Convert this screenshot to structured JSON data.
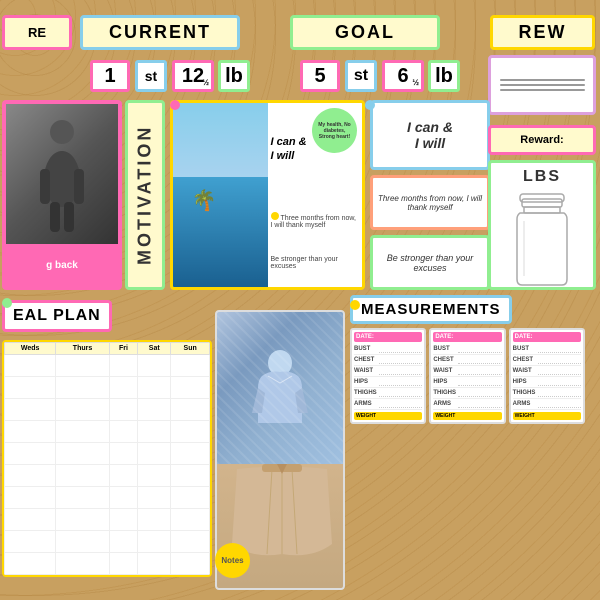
{
  "header": {
    "before_label": "RE",
    "current_label": "CURRENT",
    "goal_label": "GOAL",
    "reward_label": "REW"
  },
  "current_weight": {
    "stones": "1",
    "stones_unit": "st",
    "lbs": "12",
    "half": "½",
    "lbs_unit": "lb"
  },
  "goal_weight": {
    "stones": "5",
    "stones_unit": "st",
    "lbs": "6",
    "half": "½",
    "lbs_unit": "lb"
  },
  "motivation": {
    "label": "MOTIVATION",
    "health_text": "My health, No diabetes, Strong heart!",
    "can_will": "I can &\nI will",
    "three_months": "Three months from now, I will thank myself",
    "be_stronger": "Be stronger than your excuses",
    "holding_back": "g back"
  },
  "meal_plan": {
    "title": "EAL PLAN",
    "days": [
      "Weds",
      "Thurs",
      "Fri",
      "Sat",
      "Sun"
    ],
    "rows": 6
  },
  "measurements": {
    "title": "MEASUREMENTS",
    "fields": [
      "BUST",
      "CHEST",
      "WAIST",
      "HIPS",
      "THIGHS",
      "ARMS"
    ]
  },
  "reward": {
    "label": "Reward:",
    "lbs_label": "LBS"
  },
  "notes": {
    "label": "Notes"
  },
  "colors": {
    "pink": "#ff69b4",
    "blue": "#87ceeb",
    "green": "#90ee90",
    "yellow": "#ffd700",
    "purple": "#dda0dd",
    "orange": "#ffa07a"
  }
}
